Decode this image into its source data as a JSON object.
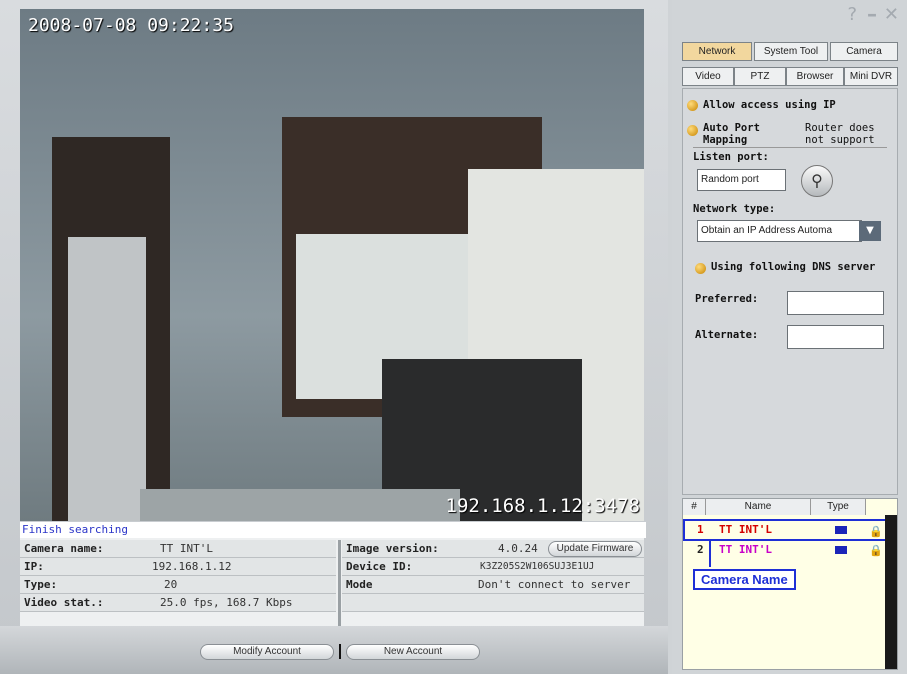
{
  "video": {
    "timestamp": "2008-07-08 09:22:35",
    "ip_overlay": "192.168.1.12:3478"
  },
  "status": {
    "message": "Finish searching",
    "left": [
      {
        "label": "Camera name:",
        "value": "TT INT'L"
      },
      {
        "label": "IP:",
        "value": "192.168.1.12"
      },
      {
        "label": "Type:",
        "value": "20"
      },
      {
        "label": "Video stat.:",
        "value": "25.0 fps, 168.7 Kbps"
      }
    ],
    "right": [
      {
        "label": "Image version:",
        "value": "4.0.24"
      },
      {
        "label": "Device ID:",
        "value": "K3Z205S2W106SUJ3E1UJ"
      },
      {
        "label": "Mode",
        "value": "Don't connect to server"
      }
    ],
    "update_firmware": "Update Firmware",
    "modify_account": "Modify Account",
    "new_account": "New Account"
  },
  "window_controls": {
    "help": "?",
    "minimize": "–",
    "close": "✕"
  },
  "tabs_row1": [
    "Network",
    "System Tool",
    "Camera"
  ],
  "tabs_row2": [
    "Video",
    "PTZ",
    "Browser",
    "Mini DVR"
  ],
  "network": {
    "allow_access": "Allow access using IP",
    "auto_port": "Auto Port Mapping",
    "router_note": "Router does not support",
    "listen_port_label": "Listen port:",
    "listen_port_value": "Random port",
    "network_type_label": "Network type:",
    "network_type_value": "Obtain an IP Address Automa",
    "dns_label": "Using following DNS server",
    "preferred_label": "Preferred:",
    "alternate_label": "Alternate:"
  },
  "camera_list": {
    "headers": [
      "#",
      "Name",
      "Type"
    ],
    "rows": [
      {
        "num": "1",
        "name": "TT INT'L"
      },
      {
        "num": "2",
        "name": "TT INT'L"
      }
    ],
    "annotation": "Camera Name"
  }
}
